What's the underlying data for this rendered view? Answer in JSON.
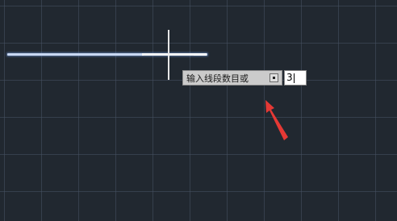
{
  "cad": {
    "prompt": {
      "label": "输入线段数目或",
      "options_icon": "dropdown-options-icon"
    },
    "input": {
      "value": "3"
    },
    "colors": {
      "background": "#212830",
      "grid": "#465262",
      "line": "#c9d8f2",
      "crosshair": "#e6e6e6",
      "annotation_arrow": "#e53935"
    }
  }
}
